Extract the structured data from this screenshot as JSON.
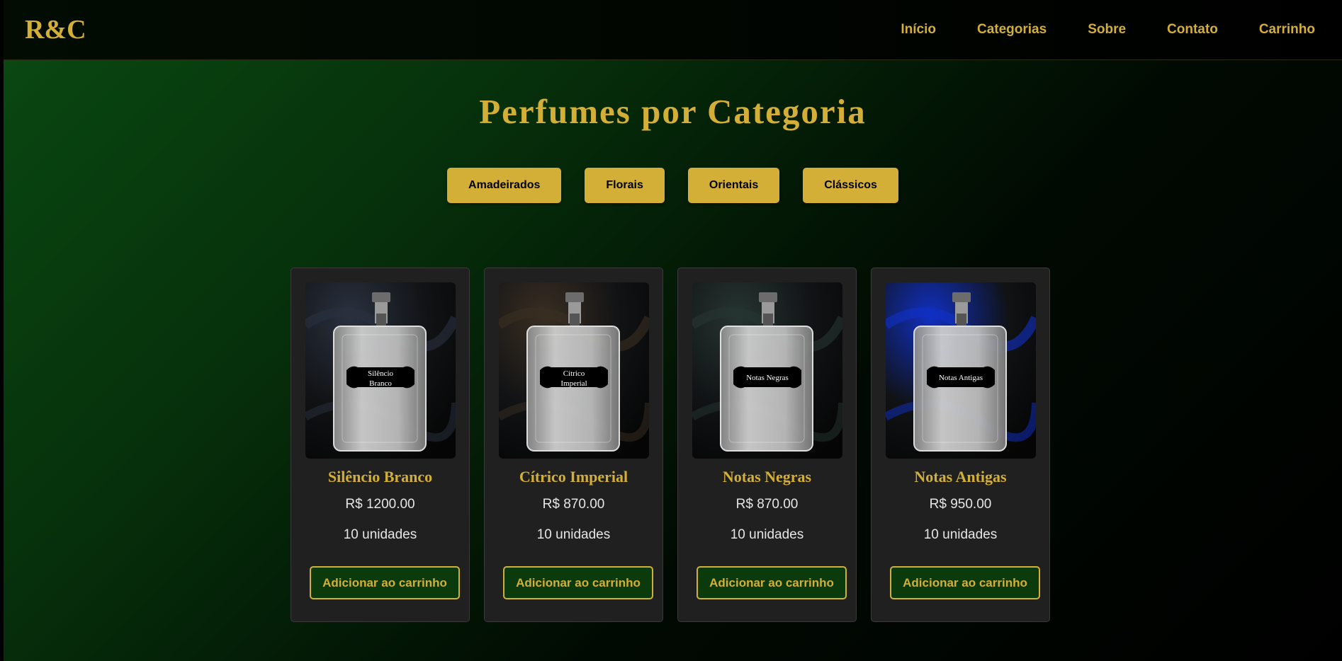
{
  "brand": {
    "logo": "R&C",
    "accent": "#d4af37"
  },
  "nav": {
    "items": [
      "Início",
      "Categorias",
      "Sobre",
      "Contato",
      "Carrinho"
    ]
  },
  "page": {
    "title": "Perfumes por Categoria"
  },
  "filters": [
    "Amadeirados",
    "Florais",
    "Orientais",
    "Clássicos"
  ],
  "products": [
    {
      "name": "Silêncio Branco",
      "price": "R$ 1200.00",
      "stock": "10 unidades",
      "button": "Adicionar ao carrinho",
      "label_lines": [
        "Silêncio",
        "Branco"
      ],
      "backdrop": "#2a3140"
    },
    {
      "name": "Cítrico Imperial",
      "price": "R$ 870.00",
      "stock": "10 unidades",
      "button": "Adicionar ao carrinho",
      "label_lines": [
        "Cítrico",
        "Imperial"
      ],
      "backdrop": "#3a2e22"
    },
    {
      "name": "Notas Negras",
      "price": "R$ 870.00",
      "stock": "10 unidades",
      "button": "Adicionar ao carrinho",
      "label_lines": [
        "Notas Negras"
      ],
      "backdrop": "#263532"
    },
    {
      "name": "Notas Antigas",
      "price": "R$ 950.00",
      "stock": "10 unidades",
      "button": "Adicionar ao carrinho",
      "label_lines": [
        "Notas Antigas"
      ],
      "backdrop": "#1030c8"
    }
  ]
}
